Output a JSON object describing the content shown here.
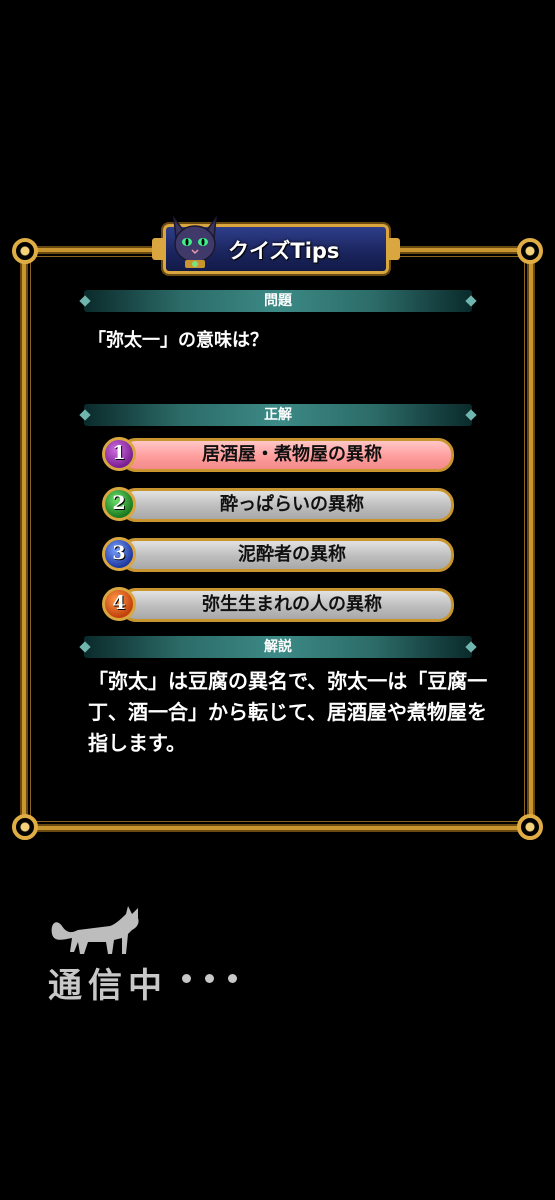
{
  "title": "クイズTips",
  "sections": {
    "question_label": "問題",
    "answer_label": "正解",
    "explanation_label": "解説"
  },
  "question": "「弥太一」の意味は？",
  "options": [
    {
      "number": "1",
      "text": "居酒屋・煮物屋の異称",
      "correct": true
    },
    {
      "number": "2",
      "text": "酔っぱらいの異称",
      "correct": false
    },
    {
      "number": "3",
      "text": "泥酔者の異称",
      "correct": false
    },
    {
      "number": "4",
      "text": "弥生生まれの人の異称",
      "correct": false
    }
  ],
  "explanation": "「弥太」は豆腐の異名で、弥太一は「豆腐一丁、酒一合」から転じて、居酒屋や煮物屋を指します。",
  "loading": {
    "text": "通信中"
  },
  "colors": {
    "frame_gold": "#c9952e",
    "section_teal": "#3c8a86",
    "correct_pink": "#ff9d9d",
    "option_gray": "#bdbdbd"
  },
  "icons": [
    "cat-mascot-icon",
    "cat-silhouette-icon"
  ]
}
